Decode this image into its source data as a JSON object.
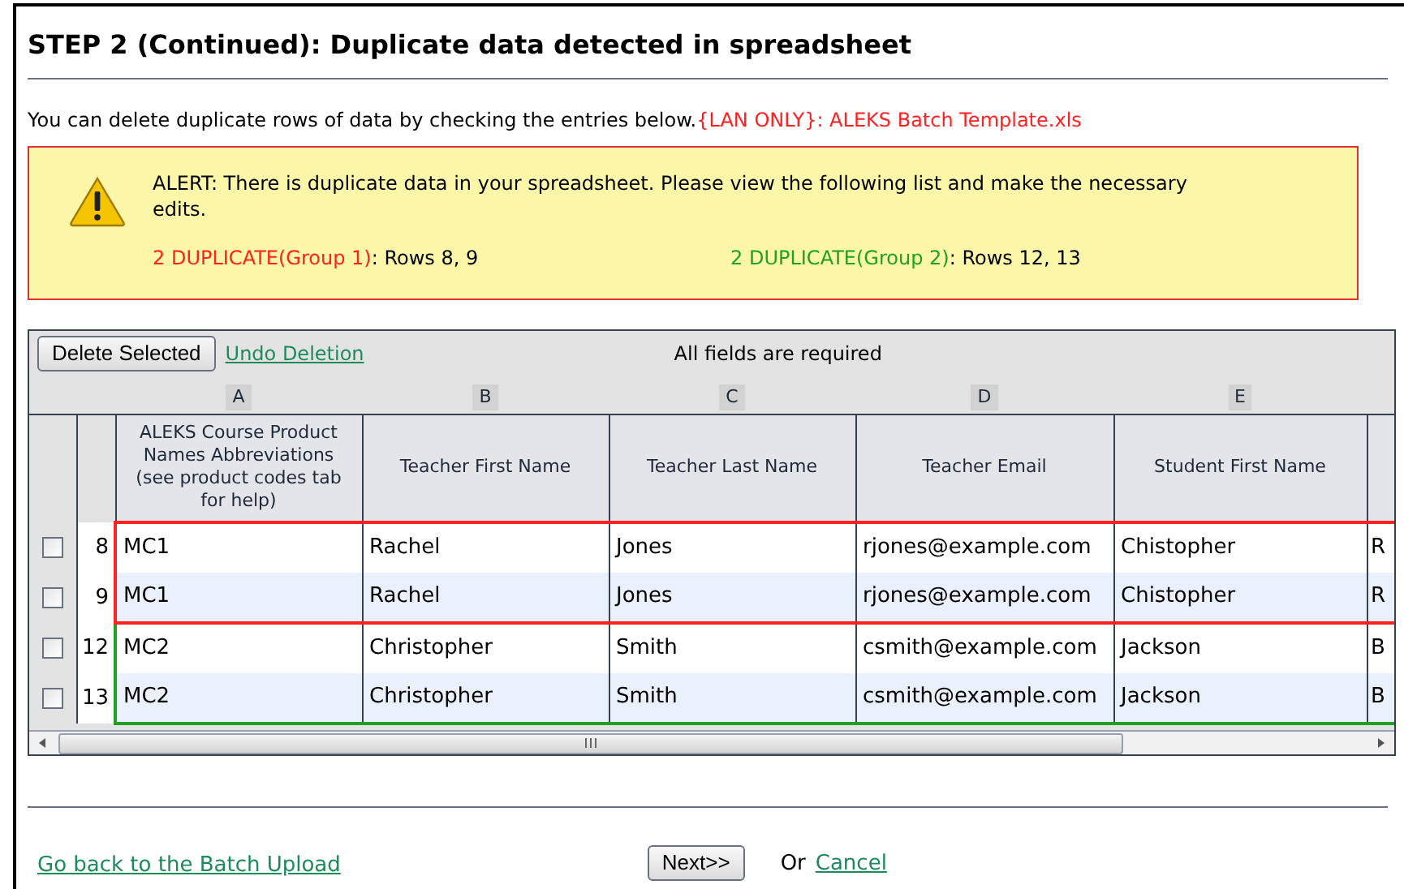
{
  "title": "STEP 2 (Continued): Duplicate data detected in spreadsheet",
  "intro": {
    "text": "You can delete duplicate rows of data by checking the entries below.",
    "file": "{LAN ONLY}: ALEKS Batch Template.xls"
  },
  "alert": {
    "message": "ALERT: There is duplicate data in your spreadsheet. Please view the following list and make the necessary edits.",
    "duplicates": [
      {
        "label": "2 DUPLICATE(Group 1)",
        "rows": ": Rows 8, 9",
        "color": "#ff2020"
      },
      {
        "label": "2 DUPLICATE(Group 2)",
        "rows": ": Rows 12, 13",
        "color": "#22a022"
      }
    ]
  },
  "toolbar": {
    "delete_button": "Delete Selected",
    "undo_link": "Undo Deletion",
    "note": "All fields are required"
  },
  "table": {
    "column_letters": [
      "A",
      "B",
      "C",
      "D",
      "E"
    ],
    "columns": [
      "ALEKS Course Product Names Abbreviations (see product codes tab for help)",
      "Teacher First Name",
      "Teacher Last Name",
      "Teacher Email",
      "Student First Name"
    ],
    "groups": [
      {
        "color": "#ff2020",
        "rows": [
          {
            "checked": false,
            "number": "8",
            "cells": [
              "MC1",
              "Rachel",
              "Jones",
              "rjones@example.com",
              "Chistopher",
              "R"
            ]
          },
          {
            "checked": false,
            "number": "9",
            "cells": [
              "MC1",
              "Rachel",
              "Jones",
              "rjones@example.com",
              "Chistopher",
              "R"
            ]
          }
        ]
      },
      {
        "color": "#22a022",
        "rows": [
          {
            "checked": false,
            "number": "12",
            "cells": [
              "MC2",
              "Christopher",
              "Smith",
              "csmith@example.com",
              "Jackson",
              "B"
            ]
          },
          {
            "checked": false,
            "number": "13",
            "cells": [
              "MC2",
              "Christopher",
              "Smith",
              "csmith@example.com",
              "Jackson",
              "B"
            ]
          }
        ]
      }
    ]
  },
  "footer": {
    "back_link": "Go back to the Batch Upload",
    "next_button": "Next>>",
    "or": "Or",
    "cancel_link": "Cancel"
  }
}
